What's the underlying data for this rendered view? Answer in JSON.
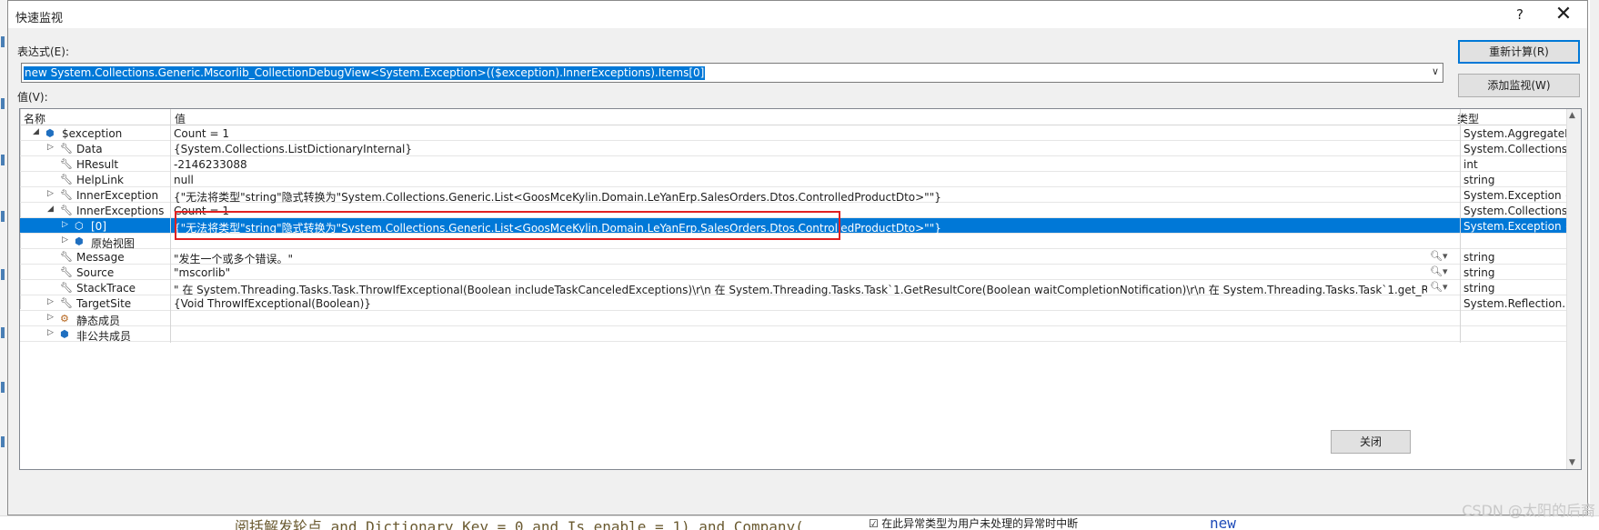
{
  "dialog": {
    "title": "快速监视",
    "help_label": "?",
    "close_icon": "✕"
  },
  "expression": {
    "label": "表达式(E):",
    "value": "new System.Collections.Generic.Mscorlib_CollectionDebugView<System.Exception>(($exception).InnerExceptions).Items[0]"
  },
  "buttons": {
    "recalc": "重新计算(R)",
    "add_watch": "添加监视(W)",
    "close": "关闭"
  },
  "value_label": "值(V):",
  "grid": {
    "headers": {
      "name": "名称",
      "value": "值",
      "type": "类型"
    },
    "rows": [
      {
        "name": "$exception",
        "value": "Count = 1",
        "type": "System.AggregateExc..."
      },
      {
        "name": "Data",
        "value": "{System.Collections.ListDictionaryInternal}",
        "type": "System.Collections.ID..."
      },
      {
        "name": "HResult",
        "value": "-2146233088",
        "type": "int"
      },
      {
        "name": "HelpLink",
        "value": "null",
        "type": "string"
      },
      {
        "name": "InnerException",
        "value": "{\"无法将类型\"string\"隐式转换为\"System.Collections.Generic.List<GoosMceKylin.Domain.LeYanErp.SalesOrders.Dtos.ControlledProductDto>\"\"}",
        "type": "System.Exception {Mi..."
      },
      {
        "name": "InnerExceptions",
        "value": "Count = 1",
        "type": "System.Collections.O..."
      },
      {
        "name": "[0]",
        "value": "{\"无法将类型\"string\"隐式转换为\"System.Collections.Generic.List<GoosMceKylin.Domain.LeYanErp.SalesOrders.Dtos.ControlledProductDto>\"\"}",
        "type": "System.Exception {Mi..."
      },
      {
        "name": "原始视图",
        "value": "",
        "type": ""
      },
      {
        "name": "Message",
        "value": "\"发生一个或多个错误。\"",
        "type": "string"
      },
      {
        "name": "Source",
        "value": "\"mscorlib\"",
        "type": "string"
      },
      {
        "name": "StackTrace",
        "value": "\"   在 System.Threading.Tasks.Task.ThrowIfExceptional(Boolean includeTaskCanceledExceptions)\\r\\n   在 System.Threading.Tasks.Task`1.GetResultCore(Boolean waitCompletionNotification)\\r\\n   在 System.Threading.Tasks.Task`1.get_Result()\\r\\n   在 GoosMce...",
        "type": "string"
      },
      {
        "name": "TargetSite",
        "value": "{Void ThrowIfExceptional(Boolean)}",
        "type": "System.Reflection.Me..."
      },
      {
        "name": "静态成员",
        "value": "",
        "type": ""
      },
      {
        "name": "非公共成员",
        "value": "",
        "type": ""
      }
    ]
  },
  "background": {
    "code_line": "阅括解发轮点 and Dictionary Key = 0 and Is enable = 1) and Company(",
    "checkbox_text": "在此异常类型为用户未处理的异常时中断",
    "keyword": "new"
  },
  "watermark": "CSDN @太阳的后裔"
}
